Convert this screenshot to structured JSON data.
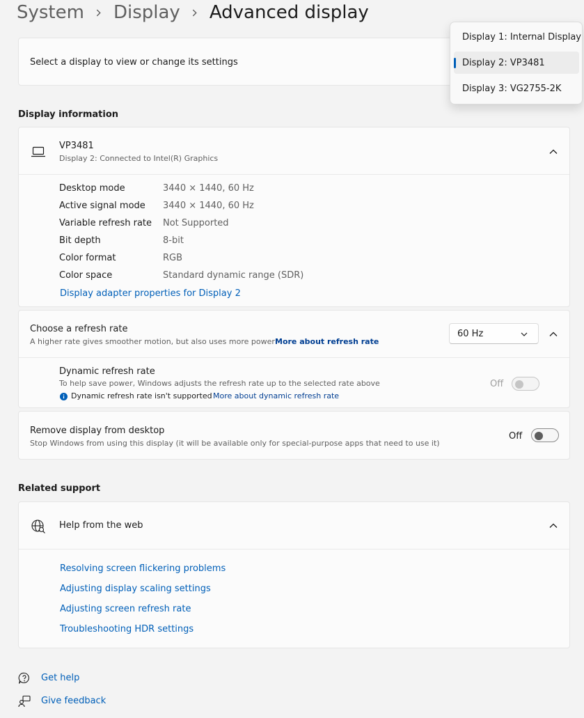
{
  "breadcrumb": {
    "items": [
      "System",
      "Display"
    ],
    "current": "Advanced display"
  },
  "select_display": {
    "label": "Select a display to view or change its settings"
  },
  "display_dropdown": {
    "options": [
      "Display 1: Internal Display",
      "Display 2: VP3481",
      "Display 3: VG2755-2K"
    ],
    "selected_index": 1
  },
  "display_information": {
    "section_title": "Display information",
    "monitor_name": "VP3481",
    "monitor_subtitle": "Display 2: Connected to Intel(R) Graphics",
    "rows": [
      {
        "label": "Desktop mode",
        "value": "3440 × 1440, 60 Hz"
      },
      {
        "label": "Active signal mode",
        "value": "3440 × 1440, 60 Hz"
      },
      {
        "label": "Variable refresh rate",
        "value": "Not Supported"
      },
      {
        "label": "Bit depth",
        "value": "8-bit"
      },
      {
        "label": "Color format",
        "value": "RGB"
      },
      {
        "label": "Color space",
        "value": "Standard dynamic range (SDR)"
      }
    ],
    "adapter_link": "Display adapter properties for Display 2"
  },
  "refresh_rate": {
    "title": "Choose a refresh rate",
    "subtitle": "A higher rate gives smoother motion, but also uses more power",
    "more_link": "More about refresh rate",
    "selected_value": "60 Hz",
    "dynamic_title": "Dynamic refresh rate",
    "dynamic_subtitle": "To help save power, Windows adjusts the refresh rate up to the selected rate above",
    "dynamic_info": "Dynamic refresh rate isn't supported",
    "dynamic_link": "More about dynamic refresh rate",
    "dynamic_state": "Off"
  },
  "remove_display": {
    "title": "Remove display from desktop",
    "subtitle": "Stop Windows from using this display (it will be available only for special-purpose apps that need to use it)",
    "state": "Off"
  },
  "related_support": {
    "section_title": "Related support",
    "help_title": "Help from the web",
    "links": [
      "Resolving screen flickering problems",
      "Adjusting display scaling settings",
      "Adjusting screen refresh rate",
      "Troubleshooting HDR settings"
    ]
  },
  "footer": {
    "get_help": "Get help",
    "give_feedback": "Give feedback"
  },
  "colors": {
    "accent": "#005fb8",
    "link": "#003e92",
    "background": "#f3f3f3",
    "card": "#fbfbfb"
  }
}
